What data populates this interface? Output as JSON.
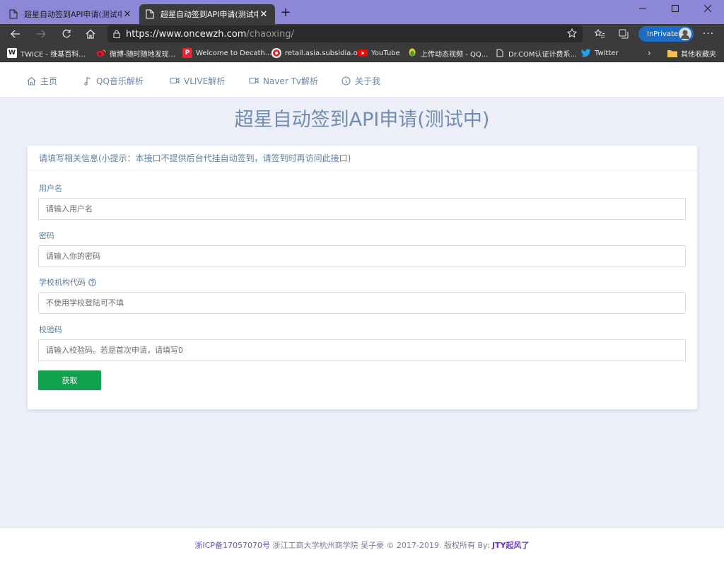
{
  "browser": {
    "tabs": [
      {
        "title": "超星自动签到API申请(测试中)",
        "active": false
      },
      {
        "title": "超星自动签到API申请(测试中)",
        "active": true
      }
    ],
    "address": {
      "url_host": "https://www.oncewzh.com",
      "url_path": "/chaoxing/"
    },
    "inprivate_label": "InPrivate",
    "bookmarks": [
      {
        "label": "TWICE - 维基百科...",
        "icon": "wikipedia-icon"
      },
      {
        "label": "微博-随时随地发现...",
        "icon": "weibo-icon"
      },
      {
        "label": "Welcome to Decath...",
        "icon": "decathlon-icon"
      },
      {
        "label": "retail.asia.subsidia.o...",
        "icon": "retail-icon"
      },
      {
        "label": "YouTube",
        "icon": "youtube-icon"
      },
      {
        "label": "上传动态视频 - QQ...",
        "icon": "qq-icon"
      },
      {
        "label": "Dr.COM认证计费系...",
        "icon": "page-icon"
      },
      {
        "label": "Twitter",
        "icon": "twitter-icon"
      },
      {
        "label": "其他收藏夹",
        "icon": "folder-icon"
      }
    ],
    "colors": {
      "titlebar": "#8c87d6",
      "toolbar": "#3b3b3b",
      "inprivate": "#1d6dc4"
    }
  },
  "nav": {
    "items": [
      {
        "label": "主页",
        "icon": "home-icon"
      },
      {
        "label": "QQ音乐解析",
        "icon": "music-icon"
      },
      {
        "label": "VLIVE解析",
        "icon": "video-icon"
      },
      {
        "label": "Naver Tv解析",
        "icon": "video-icon"
      },
      {
        "label": "关于我",
        "icon": "info-icon"
      }
    ]
  },
  "page": {
    "title": "超星自动签到API申请(测试中)",
    "card_header": "请填写相关信息(小提示：本接口不提供后台代挂自动签到，请签到时再访问此接口)",
    "fields": [
      {
        "label": "用户名",
        "placeholder": "请输入用户名",
        "value": ""
      },
      {
        "label": "密码",
        "placeholder": "请输入你的密码",
        "value": ""
      },
      {
        "label": "学校机构代码",
        "placeholder": "不使用学校登陆可不填",
        "value": "",
        "help": true
      },
      {
        "label": "校验码",
        "placeholder": "请输入校验码。若是首次申请，请填写0",
        "value": ""
      }
    ],
    "submit_label": "获取",
    "colors": {
      "title": "#6e8cb4",
      "submit": "#12a24d",
      "background": "#eceef8"
    }
  },
  "footer": {
    "icp": "浙ICP备17057070号",
    "text": " 浙江工商大学杭州商学院 吴子豪 © 2017-2019. 版权所有 By: ",
    "by": "JTY起风了"
  }
}
